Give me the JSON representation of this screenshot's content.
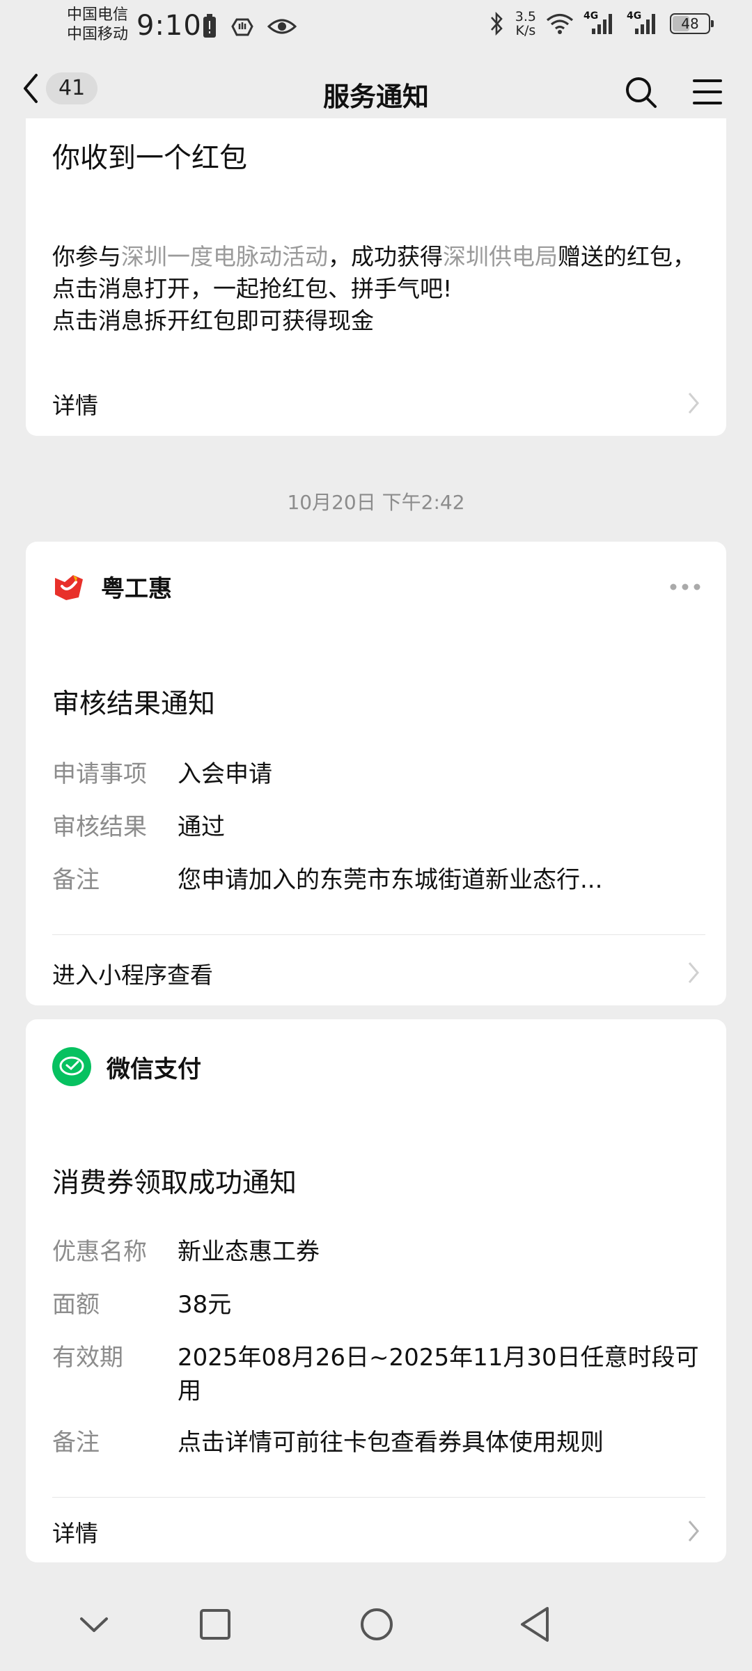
{
  "status_bar": {
    "carrier_1": "中国电信",
    "carrier_2": "中国移动",
    "time": "9:10",
    "net_speed": "3.5",
    "net_speed_unit": "K/s",
    "signal_label_1": "4G",
    "signal_label_2": "4G",
    "battery": "48",
    "battery_level": 0.48
  },
  "nav": {
    "unread_count": "41",
    "title": "服务通知"
  },
  "red_packet_card": {
    "title": "你收到一个红包",
    "body_pre": "你参与",
    "activity_link": "深圳一度电脉动活动",
    "body_mid": "，成功获得",
    "sponsor_link": "深圳供电局",
    "body_post": "赠送的红包，点击消息打开，一起抢红包、拼手气吧!",
    "line3": "点击消息拆开红包即可获得现金",
    "detail_label": "详情"
  },
  "timestamp": "10月20日 下午2:42",
  "review_card": {
    "source_name": "粤工惠",
    "title": "审核结果通知",
    "fields": [
      {
        "key": "申请事项",
        "value": "入会申请"
      },
      {
        "key": "审核结果",
        "value": "通过"
      },
      {
        "key": "备注",
        "value": "您申请加入的东莞市东城街道新业态行..."
      }
    ],
    "action_label": "进入小程序查看"
  },
  "pay_card": {
    "source_name": "微信支付",
    "title": "消费券领取成功通知",
    "fields": [
      {
        "key": "优惠名称",
        "value": "新业态惠工券"
      },
      {
        "key": "面额",
        "value": "38元"
      },
      {
        "key": "有效期",
        "value": "2025年08月26日~2025年11月30日任意时段可用"
      },
      {
        "key": "备注",
        "value": "点击详情可前往卡包查看券具体使用规则"
      }
    ],
    "action_label": "详情"
  },
  "colors": {
    "background": "#ededed",
    "card": "#ffffff",
    "muted_text": "#8c8c8c",
    "wechat_pay_green": "#07c160",
    "brand_red": "#e8302a"
  },
  "icons": [
    "back-arrow-icon",
    "search-icon",
    "menu-icon",
    "chevron-right-icon",
    "more-icon",
    "ygh-logo-icon",
    "wechat-pay-icon",
    "nav-down-icon",
    "nav-recent-icon",
    "nav-home-icon",
    "nav-back-icon"
  ]
}
